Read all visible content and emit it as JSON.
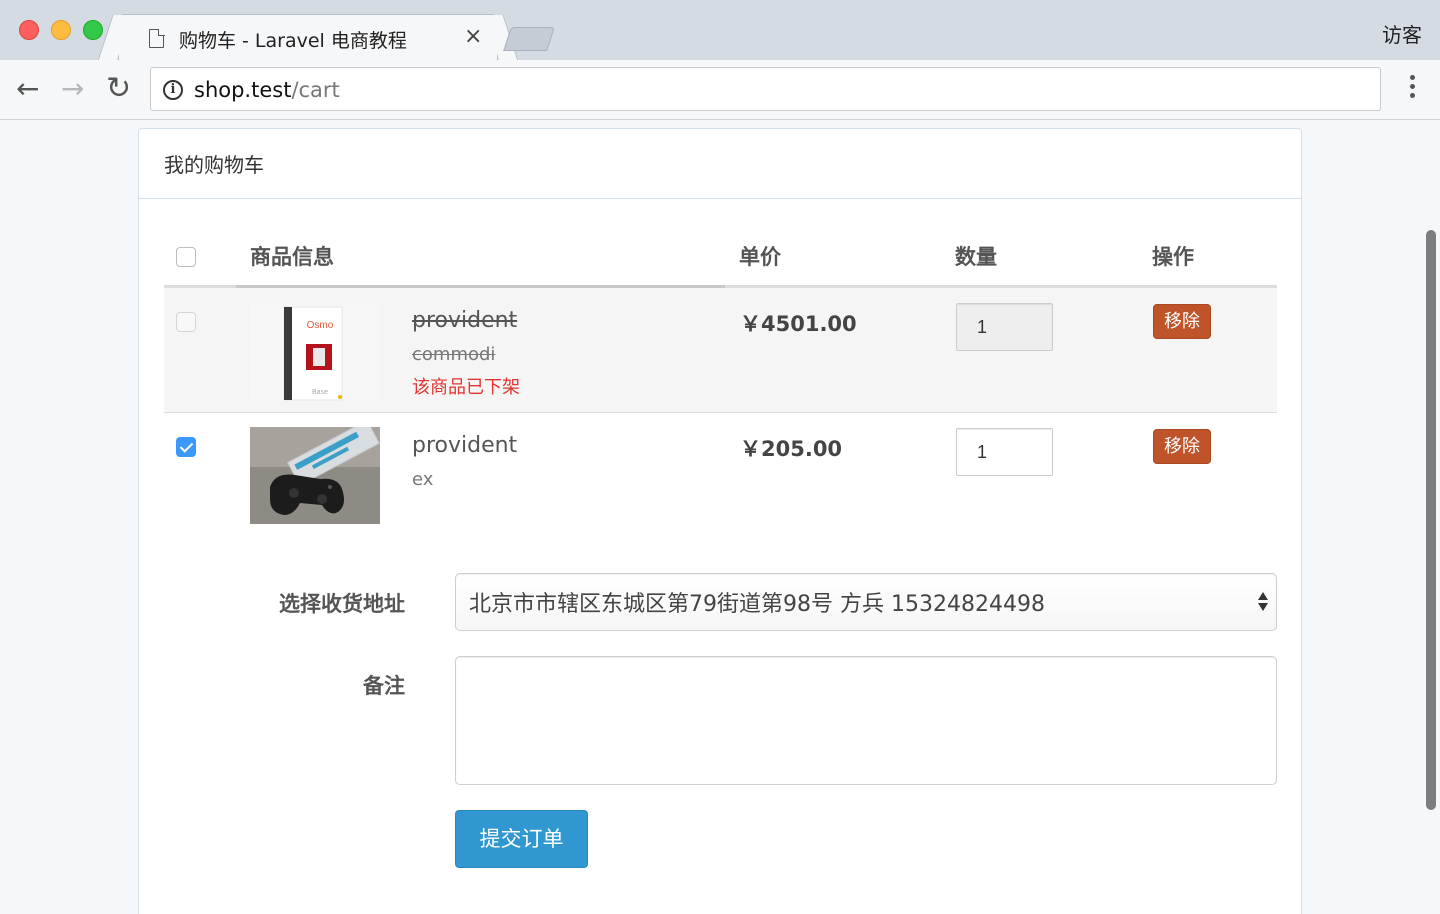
{
  "browser": {
    "tab_title": "购物车 - Laravel 电商教程",
    "tab_close": "×",
    "profile": "访客",
    "url_host": "shop.test",
    "url_path": "/cart",
    "nav": {
      "back": "←",
      "forward": "→",
      "reload": "↻"
    }
  },
  "cart": {
    "heading": "我的购物车",
    "columns": {
      "product": "商品信息",
      "price": "单价",
      "quantity": "数量",
      "action": "操作"
    },
    "items": [
      {
        "checked": false,
        "name": "provident",
        "sku": "commodi",
        "status": "该商品已下架",
        "price": "￥4501.00",
        "quantity": "1",
        "remove_label": "移除",
        "image_text": "Osmo",
        "image_subtext": "Base"
      },
      {
        "checked": true,
        "name": "provident",
        "sku": "ex",
        "price": "￥205.00",
        "quantity": "1",
        "remove_label": "移除"
      }
    ],
    "form": {
      "address_label": "选择收货地址",
      "address_value": "北京市市辖区东城区第79街道第98号 方兵 15324824498",
      "remark_label": "备注",
      "remark_value": "",
      "submit_label": "提交订单"
    }
  },
  "colors": {
    "danger": "#bf5329",
    "primary": "#3097d1",
    "unavailable_text": "#e3342f",
    "checkbox_checked": "#3b99fc"
  }
}
